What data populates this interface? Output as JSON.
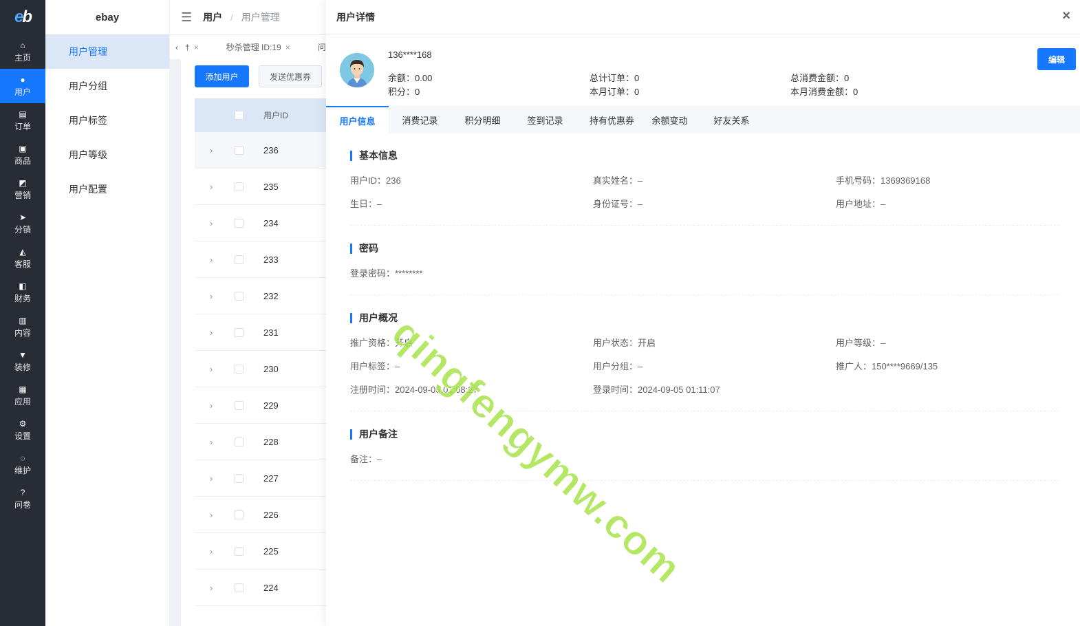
{
  "rail": {
    "logo": "eb",
    "items": [
      {
        "label": "主页",
        "icon": "home-icon",
        "glyph": "⌂"
      },
      {
        "label": "用户",
        "icon": "user-icon",
        "glyph": "●"
      },
      {
        "label": "订单",
        "icon": "order-icon",
        "glyph": "▤"
      },
      {
        "label": "商品",
        "icon": "goods-icon",
        "glyph": "▣"
      },
      {
        "label": "营销",
        "icon": "marketing-icon",
        "glyph": "◩"
      },
      {
        "label": "分销",
        "icon": "distribution-icon",
        "glyph": "➤"
      },
      {
        "label": "客服",
        "icon": "service-icon",
        "glyph": "◭"
      },
      {
        "label": "财务",
        "icon": "finance-icon",
        "glyph": "◧"
      },
      {
        "label": "内容",
        "icon": "content-icon",
        "glyph": "▥"
      },
      {
        "label": "装修",
        "icon": "decoration-icon",
        "glyph": "▼"
      },
      {
        "label": "应用",
        "icon": "apps-icon",
        "glyph": "▦"
      },
      {
        "label": "设置",
        "icon": "settings-icon",
        "glyph": "⚙"
      },
      {
        "label": "维护",
        "icon": "maintenance-icon",
        "glyph": "◌"
      },
      {
        "label": "问卷",
        "icon": "question-icon",
        "glyph": "?"
      }
    ]
  },
  "submenu": {
    "brand": "ebay",
    "items": [
      "用户管理",
      "用户分组",
      "用户标签",
      "用户等级",
      "用户配置"
    ]
  },
  "topbar": {
    "crumb1": "用户",
    "sep": "/",
    "crumb2": "用户管理"
  },
  "tagsbar": {
    "tags": [
      {
        "label": "†",
        "close": "×"
      },
      {
        "label": "秒杀管理 ID:19",
        "close": "×"
      },
      {
        "label": "问卷",
        "close": ""
      }
    ]
  },
  "list": {
    "add_button": "添加用户",
    "coupon_button": "发送优惠券",
    "col_id": "用户ID",
    "ids": [
      "236",
      "235",
      "234",
      "233",
      "232",
      "231",
      "230",
      "229",
      "228",
      "227",
      "226",
      "225",
      "224"
    ]
  },
  "drawer": {
    "title": "用户详情",
    "close": "×",
    "phone": "136****168",
    "edit_button": "编辑",
    "stats": {
      "balance": "余额：0.00",
      "points": "积分：0",
      "total_orders": "总计订单：0",
      "month_orders": "本月订单：0",
      "total_spend": "总消费金额：0",
      "month_spend": "本月消费金额：0"
    },
    "tabs": [
      "用户信息",
      "消费记录",
      "积分明细",
      "签到记录",
      "持有优惠券",
      "余额变动",
      "好友关系"
    ],
    "basic": {
      "title": "基本信息",
      "user_id": "用户ID：236",
      "real_name": "真实姓名：–",
      "mobile": "手机号码：1369369168",
      "birthday": "生日：–",
      "id_card": "身份证号：–",
      "address": "用户地址：–"
    },
    "password": {
      "title": "密码",
      "login_pwd": "登录密码：********"
    },
    "overview": {
      "title": "用户概况",
      "promo": "推广资格：开启",
      "status": "用户状态：开启",
      "level": "用户等级：–",
      "label": "用户标签：–",
      "group": "用户分组：–",
      "promoter": "推广人：150****9669/135",
      "reg_time": "注册时间：2024-09-05 01:08:27",
      "login_time": "登录时间：2024-09-05 01:11:07"
    },
    "remark": {
      "title": "用户备注",
      "note": "备注：–"
    }
  },
  "watermark": "qingfengymw.com"
}
